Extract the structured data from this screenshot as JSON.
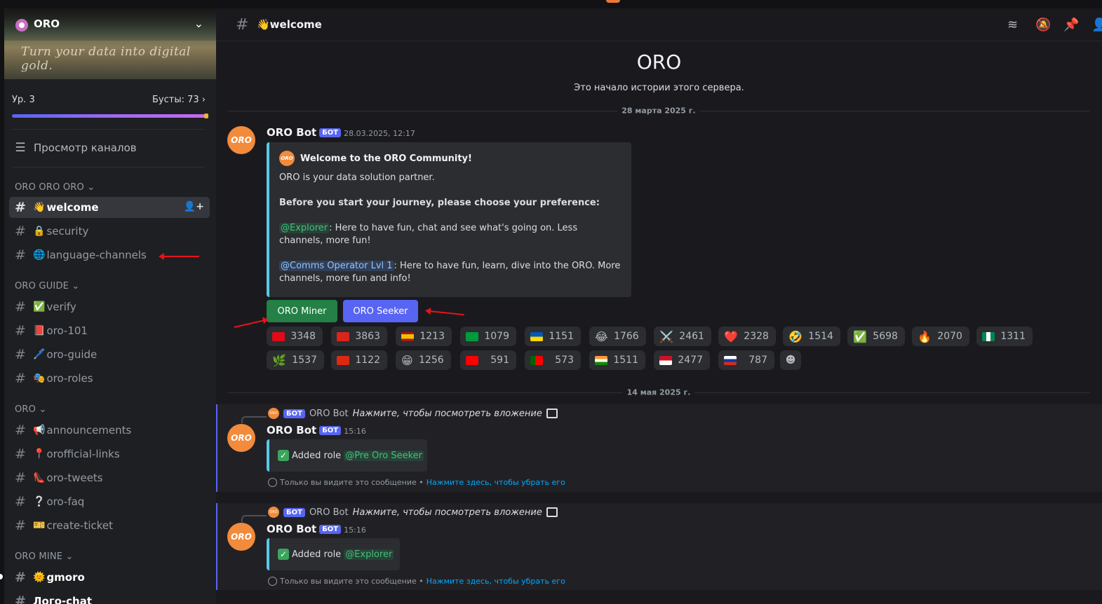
{
  "server": {
    "name": "ORO",
    "tagline": "Turn your data into digital gold.",
    "level": "Ур. 3",
    "boosts": "Бусты: 73",
    "browse_channels": "Просмотр каналов"
  },
  "sidebar": {
    "categories": [
      {
        "label": "ORO ORO ORO",
        "channels": [
          {
            "emoji": "👋",
            "name": "welcome"
          },
          {
            "emoji": "🔒",
            "name": "security"
          },
          {
            "emoji": "🌐",
            "name": "language-channels"
          }
        ]
      },
      {
        "label": "ORO GUIDE",
        "channels": [
          {
            "emoji": "✅",
            "name": "verify"
          },
          {
            "emoji": "📕",
            "name": "oro-101"
          },
          {
            "emoji": "🖊️",
            "name": "oro-guide"
          },
          {
            "emoji": "🎭",
            "name": "oro-roles"
          }
        ]
      },
      {
        "label": "ORO",
        "channels": [
          {
            "emoji": "📢",
            "name": "announcements"
          },
          {
            "emoji": "📍",
            "name": "orofficial-links"
          },
          {
            "emoji": "👠",
            "name": "oro-tweets"
          },
          {
            "emoji": "❔",
            "name": "oro-faq"
          },
          {
            "emoji": "🎫",
            "name": "create-ticket"
          }
        ]
      },
      {
        "label": "ORO MINE",
        "channels": [
          {
            "emoji": "🌞",
            "name": "gmoro"
          },
          {
            "emoji": "",
            "name": "Лого-chat"
          }
        ]
      }
    ]
  },
  "header": {
    "channel_title": "👋welcome",
    "icons": [
      "threads-icon",
      "mute-icon",
      "pin-icon",
      "members-icon"
    ]
  },
  "intro": {
    "server_name": "ORO",
    "subtitle": "Это начало истории этого сервера."
  },
  "date_separators": [
    "28 марта 2025 г.",
    "14 мая 2025 г."
  ],
  "message1": {
    "author": "ORO Bot",
    "bot_tag": "БОТ",
    "timestamp": "28.03.2025, 12:17",
    "avatar_text": "ORO",
    "embed": {
      "title": "Welcome to the ORO Community!",
      "line1": "ORO is your data solution partner.",
      "line2": "Before you start your journey, please choose your preference:",
      "explorer_mention": "@Explorer",
      "explorer_text": ": Here to have fun, chat and see what's going on. Less channels, more fun!",
      "comms_mention": "@Comms Operator Lvl 1",
      "comms_text": ": Here to have fun, learn, dive into the ORO. More channels, more fun and info!"
    },
    "buttons": [
      "ORO Miner",
      "ORO Seeker"
    ],
    "reactions_row1": [
      {
        "icon": "flag-turkey",
        "count": "3348"
      },
      {
        "icon": "flag-vietnam",
        "count": "3863"
      },
      {
        "icon": "flag-spain",
        "count": "1213"
      },
      {
        "icon": "flag-brazil",
        "count": "1079"
      },
      {
        "icon": "flag-ukraine",
        "count": "1151"
      },
      {
        "icon": "joy-emoji",
        "count": "1766"
      },
      {
        "icon": "crossed-swords-emoji",
        "count": "2461"
      },
      {
        "icon": "heart-emoji",
        "count": "2328"
      },
      {
        "icon": "rofl-emoji",
        "count": "1514"
      },
      {
        "icon": "check-emoji",
        "count": "5698"
      },
      {
        "icon": "fire-emoji",
        "count": "2070"
      },
      {
        "icon": "flag-nigeria",
        "count": "1311"
      }
    ],
    "reactions_row2": [
      {
        "icon": "custom-green-emoji",
        "count": "1537"
      },
      {
        "icon": "flag-china",
        "count": "1122"
      },
      {
        "icon": "grin-emoji",
        "count": "1256"
      },
      {
        "icon": "flag-taiwan",
        "count": "591"
      },
      {
        "icon": "flag-portugal",
        "count": "573"
      },
      {
        "icon": "flag-india",
        "count": "1511"
      },
      {
        "icon": "flag-indonesia",
        "count": "2477"
      },
      {
        "icon": "flag-russia",
        "count": "787"
      }
    ]
  },
  "message2": {
    "reply_author": "ORO Bot",
    "reply_bot_tag": "БОТ",
    "reply_text": "Нажмите, чтобы посмотреть вложение",
    "author": "ORO Bot",
    "bot_tag": "БОТ",
    "timestamp": "15:16",
    "avatar_text": "ORO",
    "embed_text": "Added role",
    "role_mention": "@Pre Oro Seeker",
    "ephemeral_text": "Только вы видите это сообщение •",
    "ephemeral_link": "Нажмите здесь, чтобы убрать его"
  },
  "message3": {
    "reply_author": "ORO Bot",
    "reply_bot_tag": "БОТ",
    "reply_text": "Нажмите, чтобы посмотреть вложение",
    "author": "ORO Bot",
    "bot_tag": "БОТ",
    "timestamp": "15:16",
    "avatar_text": "ORO",
    "embed_text": "Added role",
    "role_mention": "@Explorer",
    "ephemeral_text": "Только вы видите это сообщение •",
    "ephemeral_link": "Нажмите здесь, чтобы убрать его"
  },
  "colors": {
    "accent": "#5865f2",
    "green_button": "#248046",
    "annotation_arrow": "#e8121b",
    "embed_border": "#5ac8e6"
  }
}
